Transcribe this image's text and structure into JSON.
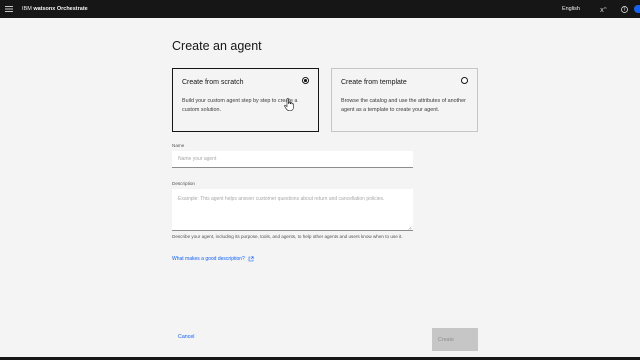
{
  "header": {
    "brand_prefix": "IBM",
    "brand_name": "watsonx Orchestrate",
    "language": "English",
    "icons": [
      "menu-icon",
      "superscript-icon",
      "help-icon",
      "avatar"
    ]
  },
  "page": {
    "title": "Create an agent"
  },
  "options": {
    "scratch": {
      "title": "Create from scratch",
      "description": "Build your custom agent step by step to create a custom solution.",
      "selected": true
    },
    "template": {
      "title": "Create from template",
      "description": "Browse the catalog and use the attributes of another agent as a template to create your agent.",
      "selected": false
    }
  },
  "form": {
    "name_label": "Name",
    "name_value": "",
    "name_placeholder": "Name your agent",
    "description_label": "Description",
    "description_value": "",
    "description_placeholder": "Example: This agent helps answer customer questions about return and cancellation policies.",
    "description_helper": "Describe your agent, including its purpose, tools, and agents, to help other agents and users know when to use it.",
    "help_link": "What makes a good description?"
  },
  "actions": {
    "cancel": "Cancel",
    "create": "Create"
  },
  "colors": {
    "accent": "#0f62fe",
    "topbar": "#161616",
    "background": "#f4f4f4",
    "disabled": "#c6c6c6"
  }
}
